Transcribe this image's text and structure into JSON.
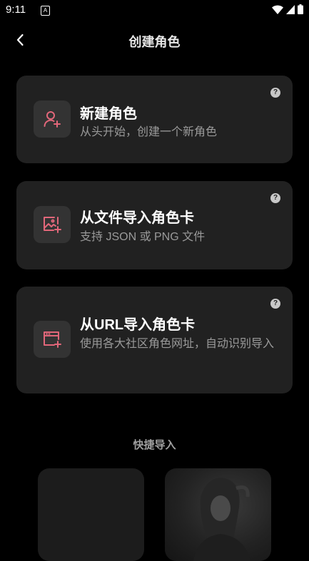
{
  "status_bar": {
    "time": "9:11",
    "app_icon_letter": "A"
  },
  "header": {
    "title": "创建角色"
  },
  "cards": [
    {
      "title": "新建角色",
      "description": "从头开始，创建一个新角色",
      "icon": "user-add-icon"
    },
    {
      "title": "从文件导入角色卡",
      "description": "支持 JSON 或 PNG 文件",
      "icon": "image-add-icon"
    },
    {
      "title": "从URL导入角色卡",
      "description": "使用各大社区角色网址，自动识别导入",
      "icon": "browser-add-icon"
    }
  ],
  "help_glyph": "?",
  "quick_import": {
    "label": "快捷导入"
  },
  "colors": {
    "accent": "#e2677a",
    "card_bg": "#212121",
    "icon_bg": "#333333"
  }
}
